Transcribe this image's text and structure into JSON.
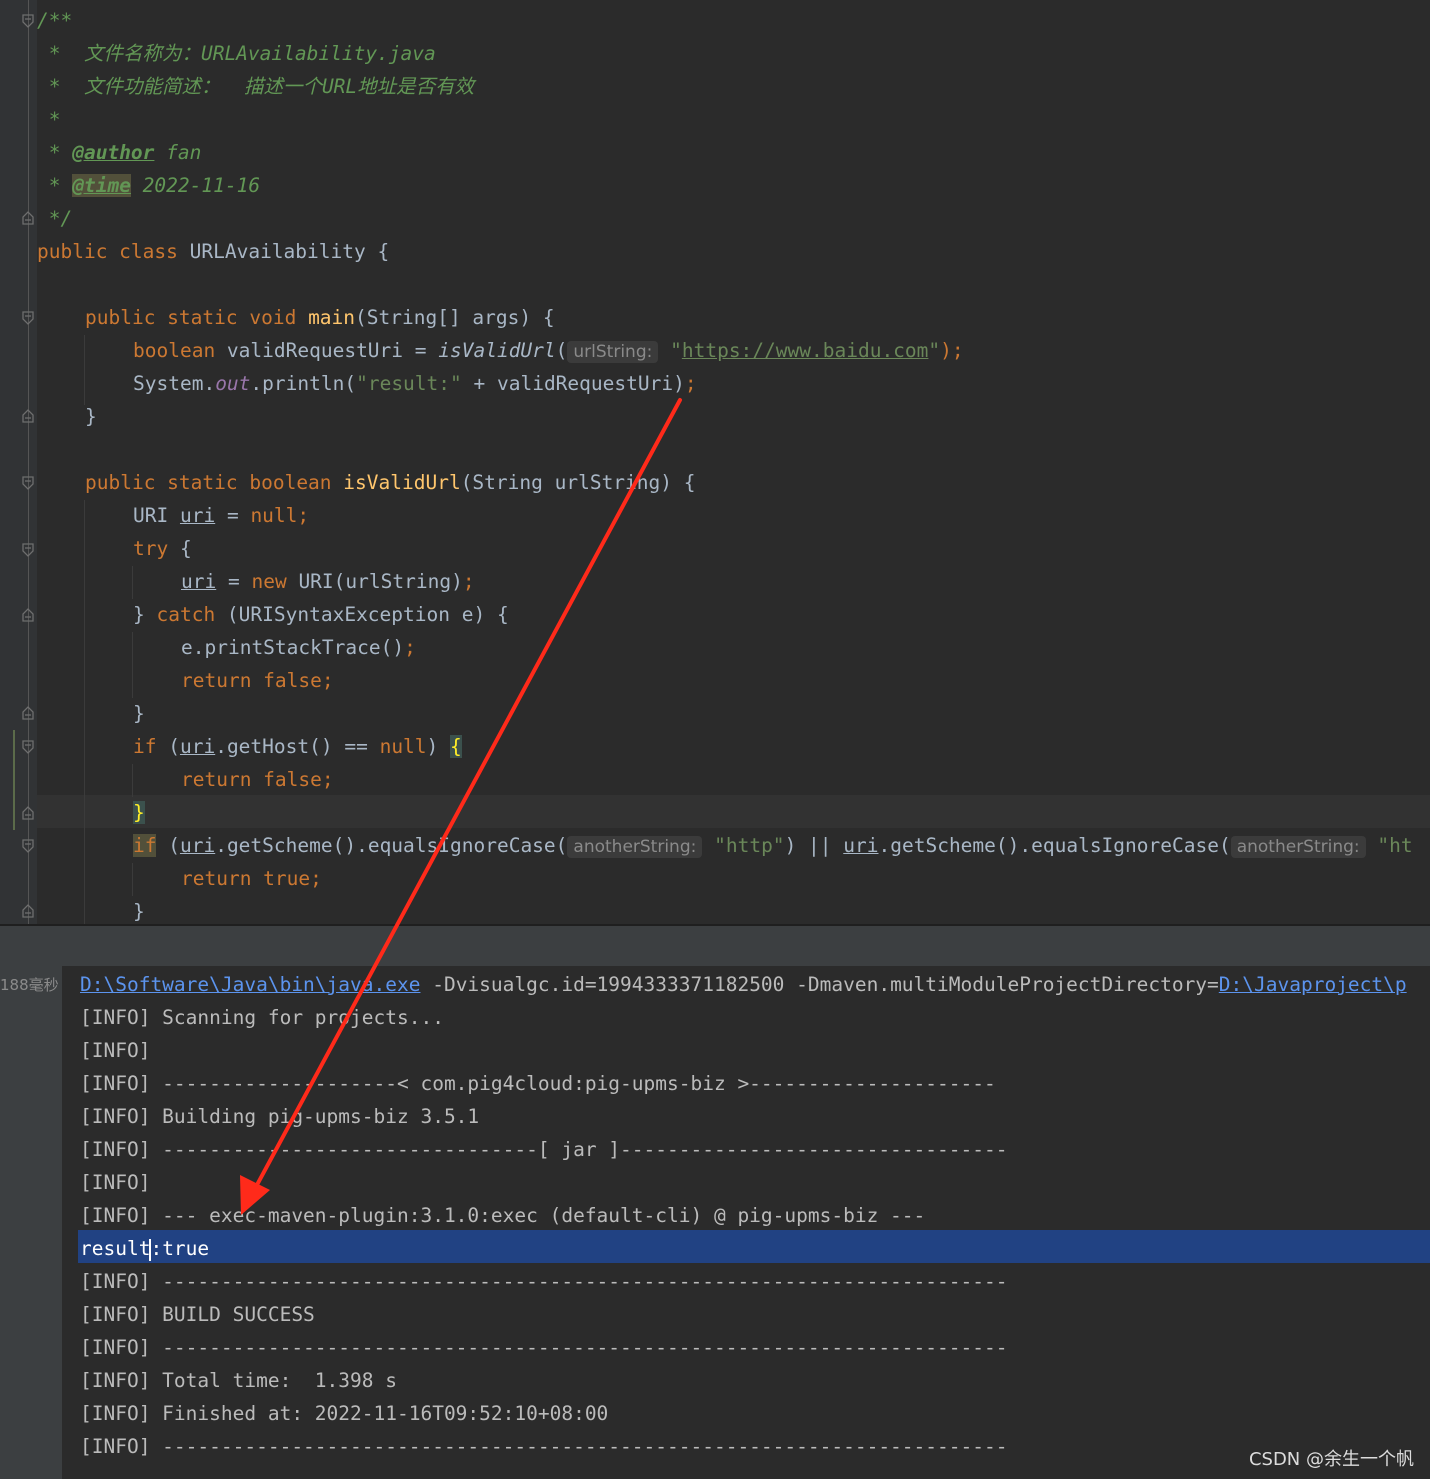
{
  "editor": {
    "javadoc": {
      "open": "/**",
      "file_name": " *  文件名称为：URLAvailability.java",
      "file_desc": " *  文件功能简述：  描述一个URL地址是否有效",
      "blank": " *",
      "author_prefix": " * ",
      "author_tag": "@author",
      "author_value": " fan",
      "time_prefix": " * ",
      "time_tag": "@time",
      "time_value": " 2022-11-16",
      "close": " */"
    },
    "class_decl": {
      "kw": "public class",
      "name": " URLAvailability {"
    },
    "main": {
      "kw": "public static void ",
      "name": "main",
      "rest": "(String[] args) {",
      "l1_kw": "boolean",
      "l1_a": " validRequestUri = ",
      "l1_call": "isValidUrl",
      "l1_paren": "(",
      "l1_hint": "urlString:",
      "l1_q1": "\"",
      "l1_url": "https://www.baidu.com",
      "l1_q2": "\"",
      "l1_end": ");",
      "l2_a": "System.",
      "l2_field": "out",
      "l2_b": ".println(",
      "l2_str": "\"result:\"",
      "l2_c": " + validRequestUri)",
      "l2_end": ";",
      "close": "}"
    },
    "isvalid": {
      "kw": "public static boolean ",
      "name": "isValidUrl",
      "rest": "(String urlString) {",
      "l1_a": "URI ",
      "l1_var": "uri",
      "l1_b": " = ",
      "l1_null": "null;",
      "try_kw": "try",
      "try_rest": " {",
      "l3_var": "uri",
      "l3_a": " = ",
      "l3_new": "new",
      "l3_b": " URI(urlString)",
      "l3_end": ";",
      "catch_a": "} ",
      "catch_kw": "catch",
      "catch_b": " (URISyntaxException e) {",
      "l5_a": "e.printStackTrace()",
      "l5_end": ";",
      "ret_false": "return false;",
      "close_brace": "}",
      "if_kw": "if",
      "if_a": " (",
      "if_var": "uri",
      "if_b": ".getHost() == ",
      "if_null": "null",
      "if_c": ") ",
      "if_brace": "{",
      "if2_kw": "if",
      "if2_a": " (",
      "if2_var": "uri",
      "if2_b": ".getScheme().equalsIgnoreCase(",
      "if2_hint": "anotherString:",
      "if2_str": "\"http\"",
      "if2_c": ") || ",
      "if2_var2": "uri",
      "if2_d": ".getScheme().equalsIgnoreCase(",
      "if2_hint2": "anotherString:",
      "if2_str2": "\"ht",
      "ret_true": "return true;"
    }
  },
  "console": {
    "timing": "188毫秒",
    "cmd_path": "D:\\Software\\Java\\bin\\java.exe",
    "cmd_args": " -Dvisualgc.id=1994333371182500 -Dmaven.multiModuleProjectDirectory=",
    "cmd_path2": "D:\\Javaproject\\p",
    "lines": [
      "[INFO] Scanning for projects...",
      "[INFO]",
      "[INFO] --------------------< com.pig4cloud:pig-upms-biz >---------------------",
      "[INFO] Building pig-upms-biz 3.5.1",
      "[INFO] --------------------------------[ jar ]---------------------------------",
      "[INFO]",
      "[INFO] --- exec-maven-plugin:3.1.0:exec (default-cli) @ pig-upms-biz ---"
    ],
    "result_a": "result",
    "result_b": ":true",
    "lines_after": [
      "[INFO] ------------------------------------------------------------------------",
      "[INFO] BUILD SUCCESS",
      "[INFO] ------------------------------------------------------------------------",
      "[INFO] Total time:  1.398 s",
      "[INFO] Finished at: 2022-11-16T09:52:10+08:00",
      "[INFO] ------------------------------------------------------------------------"
    ]
  },
  "watermark": "CSDN @余生一个帆",
  "colors": {
    "background": "#2b2b2b",
    "keyword": "#cc7832",
    "string": "#6a8759",
    "function": "#ffc66d",
    "annotation_arrow": "#ff2a1a",
    "selection": "#214283"
  }
}
